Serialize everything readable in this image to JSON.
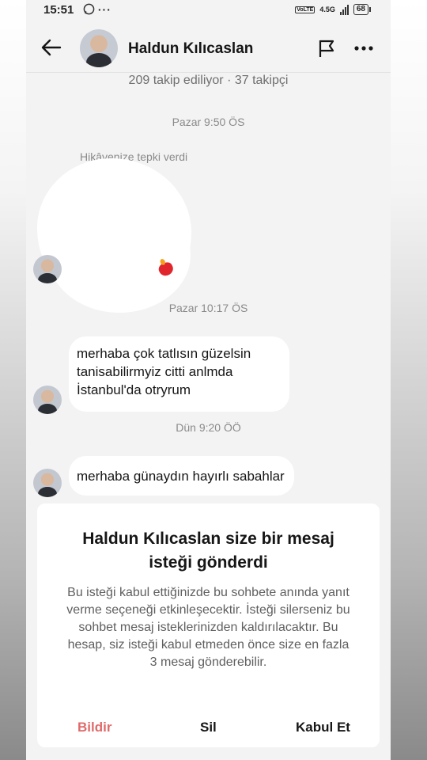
{
  "status_bar": {
    "time": "15:51",
    "left_icons": "◯ ···",
    "network": "4.5G",
    "volte": "VoLTE",
    "battery": "68"
  },
  "header": {
    "name": "Haldun Kılıcaslan"
  },
  "profile": {
    "follow_stats": "209 takip ediliyor · 37 takipçi"
  },
  "messages": {
    "ts1": "Pazar 9:50 ÖS",
    "story_reaction_label": "Hikâyenize tepki verdi",
    "ts2": "Pazar 10:17 ÖS",
    "msg1_line1": "merhaba çok tatlısın güzelsin",
    "msg1_line2": "tanisabilirmyiz citti anlmda",
    "msg1_line3": "İstanbul'da otryrum",
    "ts3": "Dün 9:20 ÖÖ",
    "msg2": "merhaba günaydın hayırlı sabahlar"
  },
  "request_card": {
    "title": "Haldun Kılıcaslan size bir mesaj isteği gönderdi",
    "body": "Bu isteği kabul ettiğinizde bu sohbete anında yanıt verme seçeneği etkinleşecektir. İsteği silerseniz bu sohbet mesaj isteklerinizden kaldırılacaktır. Bu hesap, siz isteği kabul etmeden önce size en fazla 3 mesaj gönderebilir.",
    "report": "Bildir",
    "delete": "Sil",
    "accept": "Kabul Et"
  },
  "colors": {
    "report_red": "#e06a6a",
    "page_bg": "#f3f3f3",
    "bubble_bg": "#ffffff"
  }
}
